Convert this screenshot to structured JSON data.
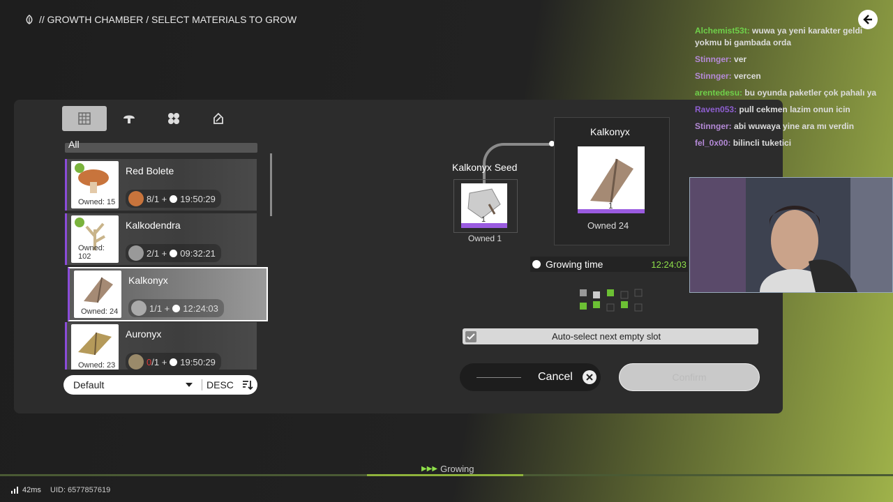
{
  "header": {
    "breadcrumb": "// GROWTH CHAMBER  / SELECT MATERIALS TO GROW"
  },
  "tabs": [
    "all-tab",
    "plant-tab",
    "flower-tab",
    "upgrade-tab"
  ],
  "category": {
    "label": "All"
  },
  "items": [
    {
      "name": "Red Bolete",
      "owned": "Owned: 15",
      "req": "8/1 +",
      "time": "19:50:29"
    },
    {
      "name": "Kalkodendra",
      "owned": "Owned: 102",
      "req": "2/1 +",
      "time": "09:32:21"
    },
    {
      "name": "Kalkonyx",
      "owned": "Owned: 24",
      "req": "1/1 +",
      "time": "12:24:03"
    },
    {
      "name": "Auronyx",
      "owned": "Owned: 23",
      "req_zero": "0",
      "req": "/1 +",
      "time": "19:50:29"
    }
  ],
  "sort": {
    "label": "Default",
    "order": "DESC"
  },
  "recipe": {
    "seed_name": "Kalkonyx Seed",
    "seed_count": "1",
    "seed_owned": "Owned 1",
    "output_name": "Kalkonyx",
    "output_count": "1",
    "output_owned": "Owned 24",
    "growing_time_label": "Growing time",
    "growing_time": "12:24:03"
  },
  "auto_select": {
    "label": "Auto-select next empty slot",
    "checked": true
  },
  "buttons": {
    "cancel": "Cancel",
    "confirm": "Confirm"
  },
  "chat": [
    {
      "user": "Alchemist53t",
      "msg": "wuwa ya yeni karakter geldi",
      "color": "#6fd04a"
    },
    {
      "user": "",
      "msg": "yokmu bi gambada orda",
      "color": "#6fd04a"
    },
    {
      "user": "Stinnger",
      "msg": "ver",
      "color": "#b58ad8"
    },
    {
      "user": "Stinnger",
      "msg": "vercen",
      "color": "#b58ad8"
    },
    {
      "user": "arentedesu",
      "msg": "bu oyunda paketler çok pahalı ya",
      "color": "#6fd04a"
    },
    {
      "user": "Raven053",
      "msg": "pull cekmen lazim onun icin",
      "color": "#8e5fd0"
    },
    {
      "user": "Stinnger",
      "msg": "abi wuwaya yine ara mı verdin",
      "color": "#b58ad8"
    },
    {
      "user": "fel_0x00",
      "msg": "bilincli tuketici",
      "color": "#b58ad8"
    }
  ],
  "footer": {
    "status": "Growing",
    "ping": "42ms",
    "uid": "UID: 6577857619"
  },
  "colors": {
    "accent_purple": "#8a4cd8",
    "time_green": "#8fe04a",
    "progress_green": "#8fb33c"
  }
}
